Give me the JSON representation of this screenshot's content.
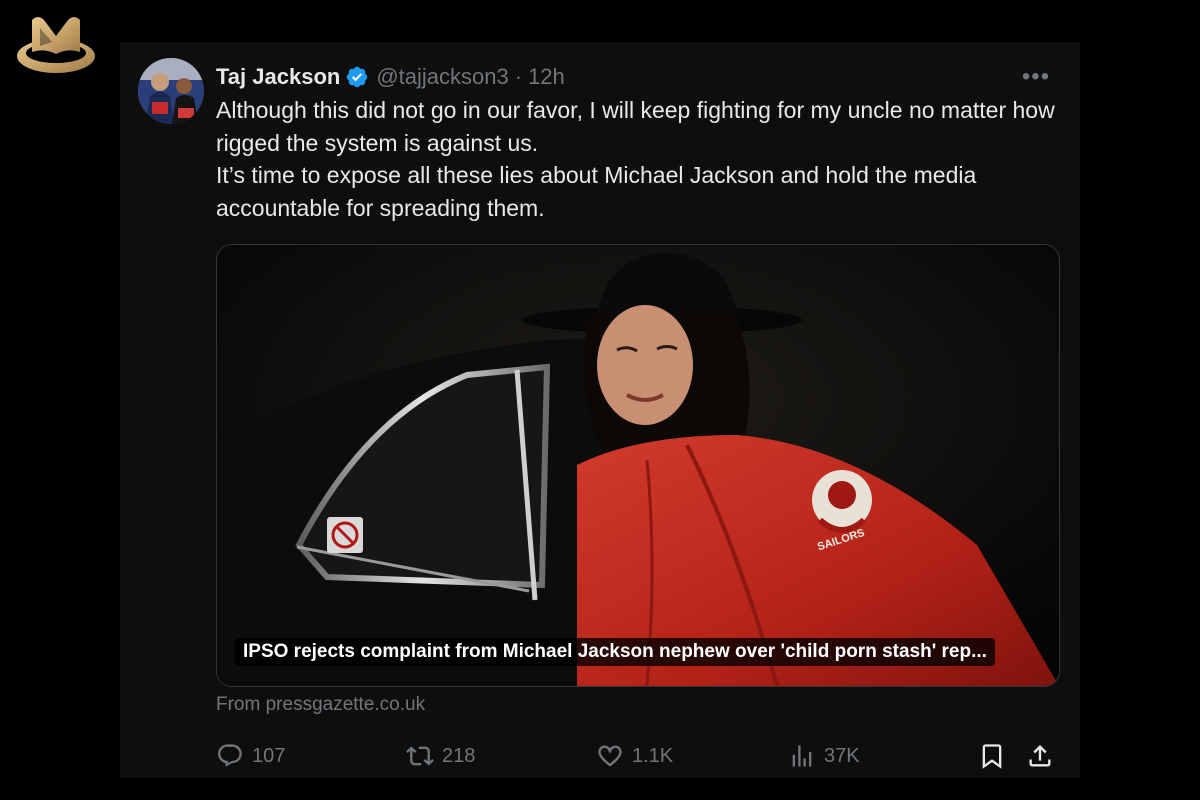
{
  "tweet": {
    "author_name": "Taj Jackson",
    "verified": true,
    "handle": "@tajjackson3",
    "separator": "·",
    "time": "12h",
    "more_label": "•••",
    "text_lines": [
      "Although this did not go in our favor, I will keep fighting for my uncle no matter how rigged the system is against us.",
      "It’s time to expose all these lies about Michael Jackson and hold the media accountable for spreading them."
    ],
    "card": {
      "caption": "IPSO rejects complaint from Michael Jackson nephew over 'child porn stash' rep...",
      "jacket_text": "SAILORS"
    },
    "source": "From pressgazette.co.uk",
    "actions": {
      "replies": "107",
      "reposts": "218",
      "likes": "1.1K",
      "views": "37K"
    }
  },
  "colors": {
    "background": "#000000",
    "card_background": "#0e0e0e",
    "text": "#e7e9ea",
    "muted": "#71767b",
    "verified_blue": "#1d9bf0",
    "logo_gold": "#c9a56b"
  },
  "icons": {
    "site_logo": "gold-hat-logo-icon",
    "verified": "verified-badge-icon",
    "reply": "reply-icon",
    "repost": "repost-icon",
    "like": "heart-icon",
    "views": "views-icon",
    "bookmark": "bookmark-icon",
    "share": "share-icon"
  }
}
